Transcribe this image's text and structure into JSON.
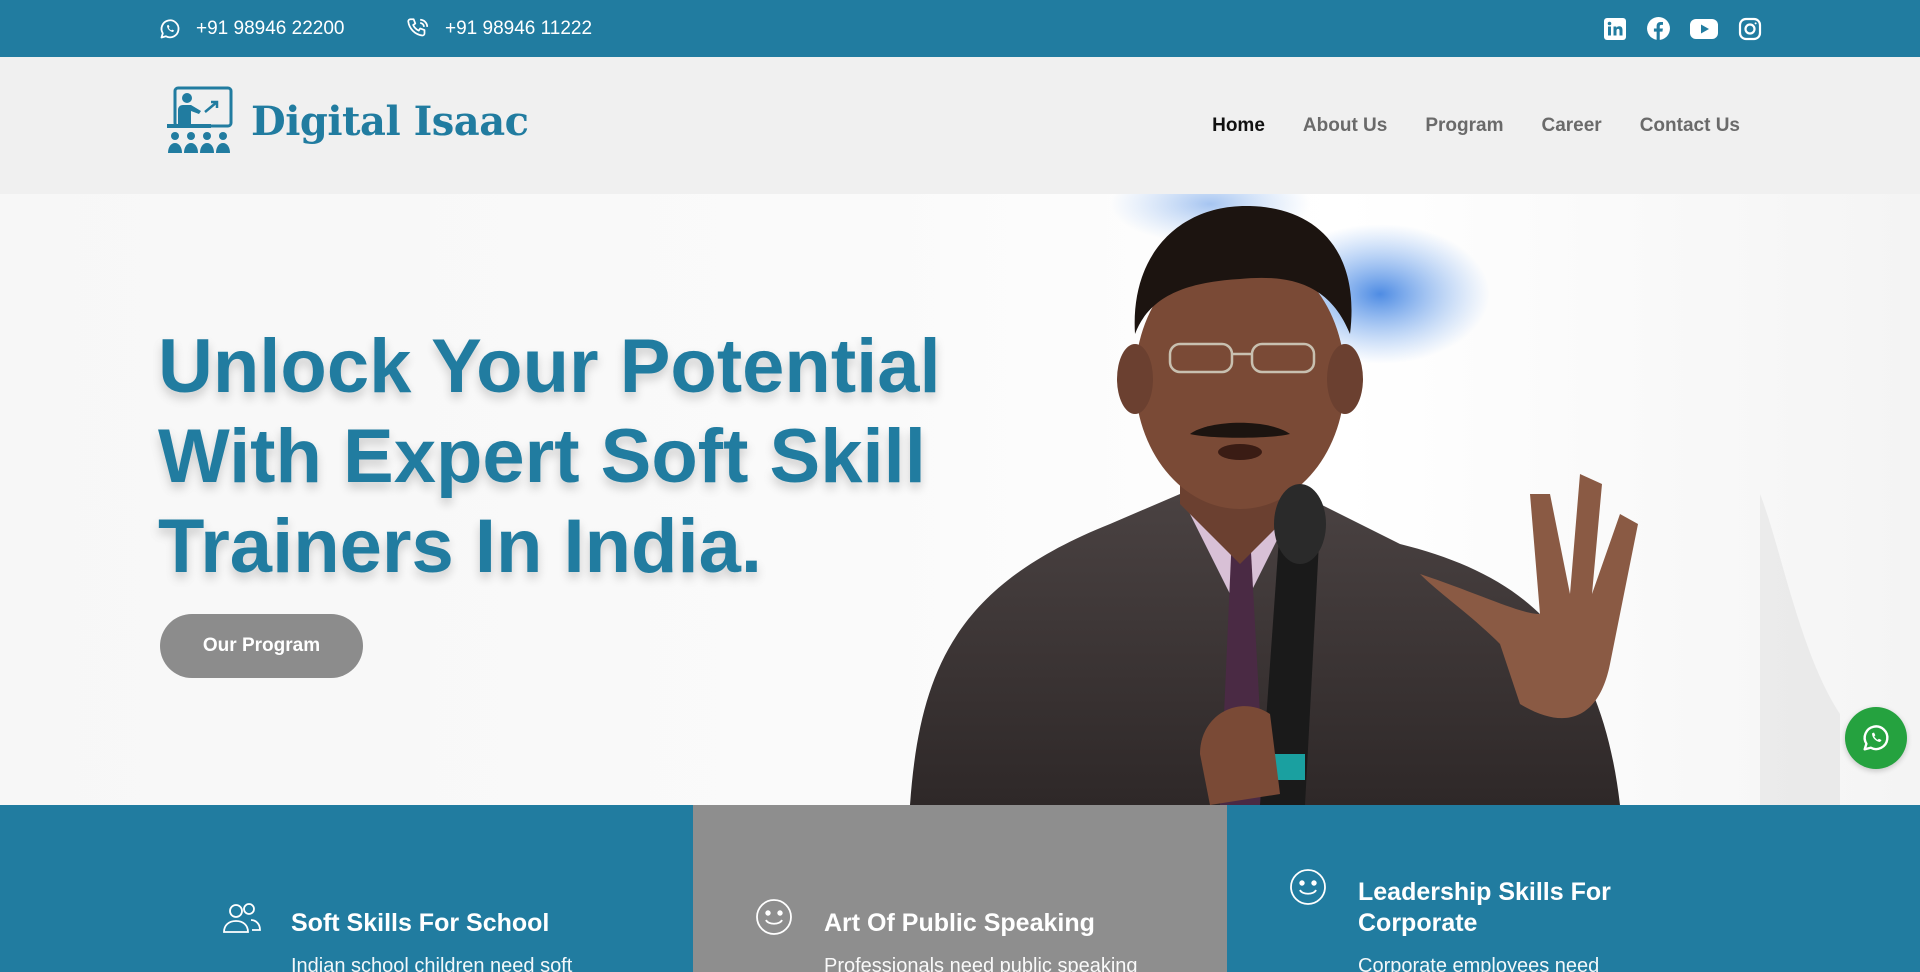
{
  "topbar": {
    "whatsapp_phone": "+91 98946 22200",
    "call_phone": "+91 98946 11222",
    "social": [
      "linkedin-icon",
      "facebook-icon",
      "youtube-icon",
      "instagram-icon"
    ]
  },
  "header": {
    "logo_text": "Digital Isaac",
    "nav": [
      {
        "label": "Home",
        "active": true
      },
      {
        "label": "About Us"
      },
      {
        "label": "Program"
      },
      {
        "label": "Career"
      },
      {
        "label": "Contact Us"
      }
    ]
  },
  "hero": {
    "title_line1": "Unlock Your Potential",
    "title_line2": "With Expert Soft Skill",
    "title_line3": "Trainers In India.",
    "button_label": "Our Program"
  },
  "features": [
    {
      "title": "Soft Skills For School",
      "desc": "Indian school children need soft",
      "icon": "users-icon"
    },
    {
      "title": "Art Of Public Speaking",
      "desc": "Professionals need public speaking",
      "icon": "smile-icon"
    },
    {
      "title": "Leadership Skills For Corporate",
      "desc": "Corporate employees need",
      "icon": "smile-icon"
    }
  ],
  "colors": {
    "brand": "#217ca0",
    "header_bg": "#f0f0f0",
    "button_gray": "#8c8c8c",
    "whatsapp_green": "#25a23f"
  }
}
